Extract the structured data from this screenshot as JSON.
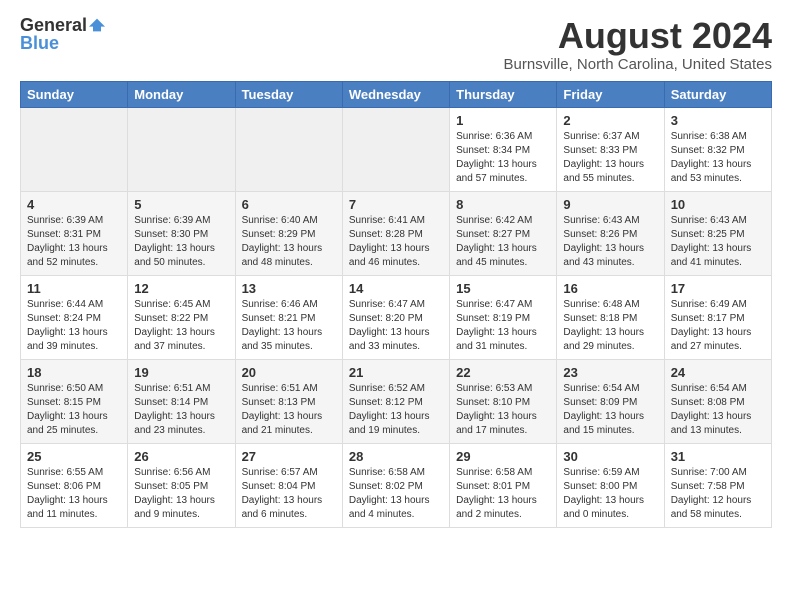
{
  "header": {
    "logo_general": "General",
    "logo_blue": "Blue",
    "month_year": "August 2024",
    "location": "Burnsville, North Carolina, United States"
  },
  "calendar": {
    "headers": [
      "Sunday",
      "Monday",
      "Tuesday",
      "Wednesday",
      "Thursday",
      "Friday",
      "Saturday"
    ],
    "rows": [
      [
        {
          "day": "",
          "detail": ""
        },
        {
          "day": "",
          "detail": ""
        },
        {
          "day": "",
          "detail": ""
        },
        {
          "day": "",
          "detail": ""
        },
        {
          "day": "1",
          "detail": "Sunrise: 6:36 AM\nSunset: 8:34 PM\nDaylight: 13 hours\nand 57 minutes."
        },
        {
          "day": "2",
          "detail": "Sunrise: 6:37 AM\nSunset: 8:33 PM\nDaylight: 13 hours\nand 55 minutes."
        },
        {
          "day": "3",
          "detail": "Sunrise: 6:38 AM\nSunset: 8:32 PM\nDaylight: 13 hours\nand 53 minutes."
        }
      ],
      [
        {
          "day": "4",
          "detail": "Sunrise: 6:39 AM\nSunset: 8:31 PM\nDaylight: 13 hours\nand 52 minutes."
        },
        {
          "day": "5",
          "detail": "Sunrise: 6:39 AM\nSunset: 8:30 PM\nDaylight: 13 hours\nand 50 minutes."
        },
        {
          "day": "6",
          "detail": "Sunrise: 6:40 AM\nSunset: 8:29 PM\nDaylight: 13 hours\nand 48 minutes."
        },
        {
          "day": "7",
          "detail": "Sunrise: 6:41 AM\nSunset: 8:28 PM\nDaylight: 13 hours\nand 46 minutes."
        },
        {
          "day": "8",
          "detail": "Sunrise: 6:42 AM\nSunset: 8:27 PM\nDaylight: 13 hours\nand 45 minutes."
        },
        {
          "day": "9",
          "detail": "Sunrise: 6:43 AM\nSunset: 8:26 PM\nDaylight: 13 hours\nand 43 minutes."
        },
        {
          "day": "10",
          "detail": "Sunrise: 6:43 AM\nSunset: 8:25 PM\nDaylight: 13 hours\nand 41 minutes."
        }
      ],
      [
        {
          "day": "11",
          "detail": "Sunrise: 6:44 AM\nSunset: 8:24 PM\nDaylight: 13 hours\nand 39 minutes."
        },
        {
          "day": "12",
          "detail": "Sunrise: 6:45 AM\nSunset: 8:22 PM\nDaylight: 13 hours\nand 37 minutes."
        },
        {
          "day": "13",
          "detail": "Sunrise: 6:46 AM\nSunset: 8:21 PM\nDaylight: 13 hours\nand 35 minutes."
        },
        {
          "day": "14",
          "detail": "Sunrise: 6:47 AM\nSunset: 8:20 PM\nDaylight: 13 hours\nand 33 minutes."
        },
        {
          "day": "15",
          "detail": "Sunrise: 6:47 AM\nSunset: 8:19 PM\nDaylight: 13 hours\nand 31 minutes."
        },
        {
          "day": "16",
          "detail": "Sunrise: 6:48 AM\nSunset: 8:18 PM\nDaylight: 13 hours\nand 29 minutes."
        },
        {
          "day": "17",
          "detail": "Sunrise: 6:49 AM\nSunset: 8:17 PM\nDaylight: 13 hours\nand 27 minutes."
        }
      ],
      [
        {
          "day": "18",
          "detail": "Sunrise: 6:50 AM\nSunset: 8:15 PM\nDaylight: 13 hours\nand 25 minutes."
        },
        {
          "day": "19",
          "detail": "Sunrise: 6:51 AM\nSunset: 8:14 PM\nDaylight: 13 hours\nand 23 minutes."
        },
        {
          "day": "20",
          "detail": "Sunrise: 6:51 AM\nSunset: 8:13 PM\nDaylight: 13 hours\nand 21 minutes."
        },
        {
          "day": "21",
          "detail": "Sunrise: 6:52 AM\nSunset: 8:12 PM\nDaylight: 13 hours\nand 19 minutes."
        },
        {
          "day": "22",
          "detail": "Sunrise: 6:53 AM\nSunset: 8:10 PM\nDaylight: 13 hours\nand 17 minutes."
        },
        {
          "day": "23",
          "detail": "Sunrise: 6:54 AM\nSunset: 8:09 PM\nDaylight: 13 hours\nand 15 minutes."
        },
        {
          "day": "24",
          "detail": "Sunrise: 6:54 AM\nSunset: 8:08 PM\nDaylight: 13 hours\nand 13 minutes."
        }
      ],
      [
        {
          "day": "25",
          "detail": "Sunrise: 6:55 AM\nSunset: 8:06 PM\nDaylight: 13 hours\nand 11 minutes."
        },
        {
          "day": "26",
          "detail": "Sunrise: 6:56 AM\nSunset: 8:05 PM\nDaylight: 13 hours\nand 9 minutes."
        },
        {
          "day": "27",
          "detail": "Sunrise: 6:57 AM\nSunset: 8:04 PM\nDaylight: 13 hours\nand 6 minutes."
        },
        {
          "day": "28",
          "detail": "Sunrise: 6:58 AM\nSunset: 8:02 PM\nDaylight: 13 hours\nand 4 minutes."
        },
        {
          "day": "29",
          "detail": "Sunrise: 6:58 AM\nSunset: 8:01 PM\nDaylight: 13 hours\nand 2 minutes."
        },
        {
          "day": "30",
          "detail": "Sunrise: 6:59 AM\nSunset: 8:00 PM\nDaylight: 13 hours\nand 0 minutes."
        },
        {
          "day": "31",
          "detail": "Sunrise: 7:00 AM\nSunset: 7:58 PM\nDaylight: 12 hours\nand 58 minutes."
        }
      ]
    ]
  }
}
